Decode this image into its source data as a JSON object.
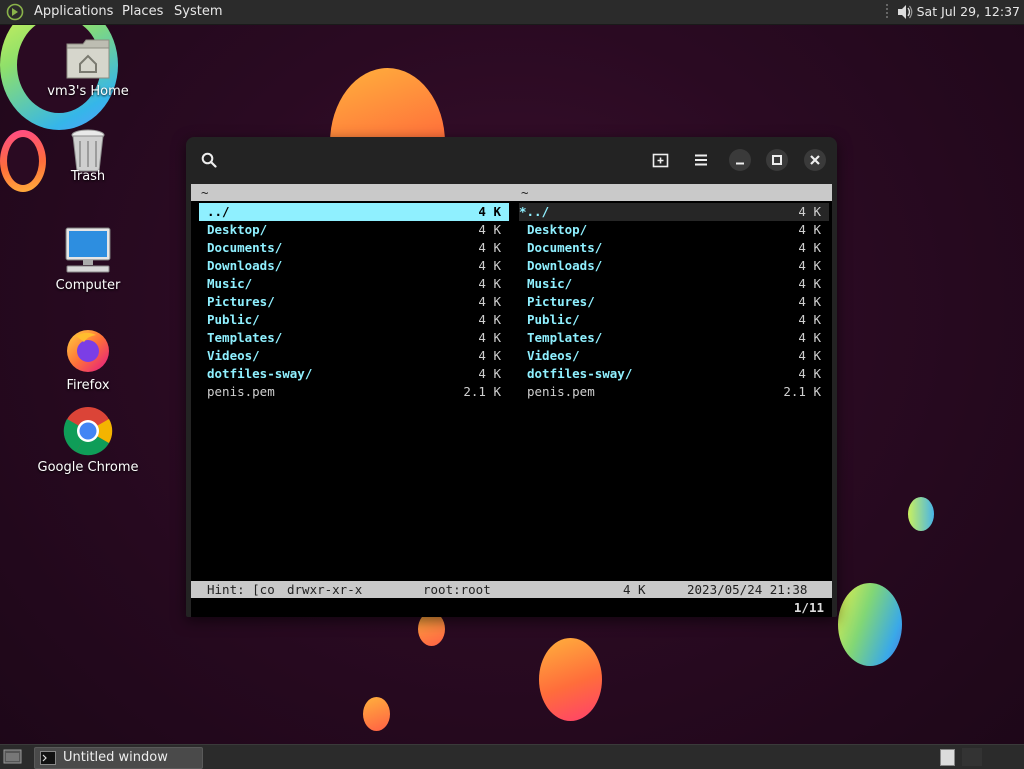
{
  "top_panel": {
    "menus": [
      "Applications",
      "Places",
      "System"
    ],
    "clock": "Sat Jul 29, 12:37",
    "icons": [
      "distro-logo-icon",
      "volume-icon"
    ]
  },
  "desktop": {
    "icons": [
      {
        "label": "vm3's Home",
        "icon": "home-folder-icon"
      },
      {
        "label": "Trash",
        "icon": "trash-icon"
      },
      {
        "label": "Computer",
        "icon": "computer-icon"
      },
      {
        "label": "Firefox",
        "icon": "firefox-icon"
      },
      {
        "label": "Google Chrome",
        "icon": "chrome-icon"
      }
    ]
  },
  "window": {
    "toolbar_icons": [
      "search-icon",
      "new-tab-icon",
      "menu-icon",
      "minimize-icon",
      "maximize-icon",
      "close-icon"
    ],
    "left_pane": {
      "header": "~",
      "rows": [
        {
          "name": "../",
          "size": "4 K",
          "type": "dir",
          "selected": true
        },
        {
          "name": "Desktop/",
          "size": "4 K",
          "type": "dir"
        },
        {
          "name": "Documents/",
          "size": "4 K",
          "type": "dir"
        },
        {
          "name": "Downloads/",
          "size": "4 K",
          "type": "dir"
        },
        {
          "name": "Music/",
          "size": "4 K",
          "type": "dir"
        },
        {
          "name": "Pictures/",
          "size": "4 K",
          "type": "dir"
        },
        {
          "name": "Public/",
          "size": "4 K",
          "type": "dir"
        },
        {
          "name": "Templates/",
          "size": "4 K",
          "type": "dir"
        },
        {
          "name": "Videos/",
          "size": "4 K",
          "type": "dir"
        },
        {
          "name": "dotfiles-sway/",
          "size": "4 K",
          "type": "dir"
        },
        {
          "name": "penis.pem",
          "size": "2.1 K",
          "type": "file"
        }
      ]
    },
    "right_pane": {
      "header": "~",
      "rows": [
        {
          "name": "*../",
          "size": "4 K",
          "type": "dir",
          "inactive_cursor": true
        },
        {
          "name": "Desktop/",
          "size": "4 K",
          "type": "dir"
        },
        {
          "name": "Documents/",
          "size": "4 K",
          "type": "dir"
        },
        {
          "name": "Downloads/",
          "size": "4 K",
          "type": "dir"
        },
        {
          "name": "Music/",
          "size": "4 K",
          "type": "dir"
        },
        {
          "name": "Pictures/",
          "size": "4 K",
          "type": "dir"
        },
        {
          "name": "Public/",
          "size": "4 K",
          "type": "dir"
        },
        {
          "name": "Templates/",
          "size": "4 K",
          "type": "dir"
        },
        {
          "name": "Videos/",
          "size": "4 K",
          "type": "dir"
        },
        {
          "name": "dotfiles-sway/",
          "size": "4 K",
          "type": "dir"
        },
        {
          "name": "penis.pem",
          "size": "2.1 K",
          "type": "file"
        }
      ]
    },
    "status": {
      "hint": "Hint: [co",
      "perms": "drwxr-xr-x",
      "owner": "root:root",
      "size": "4 K",
      "mtime": "2023/05/24 21:38"
    },
    "position": "1/11"
  },
  "taskbar": {
    "task_label": "Untitled window",
    "icons": [
      "show-desktop-icon",
      "terminal-icon",
      "workspace-icon"
    ]
  },
  "colors": {
    "directory": "#8ff0ff",
    "file": "#cfcfcf",
    "panel": "#2b2b2b",
    "status_bar": "#c9c9c9"
  }
}
